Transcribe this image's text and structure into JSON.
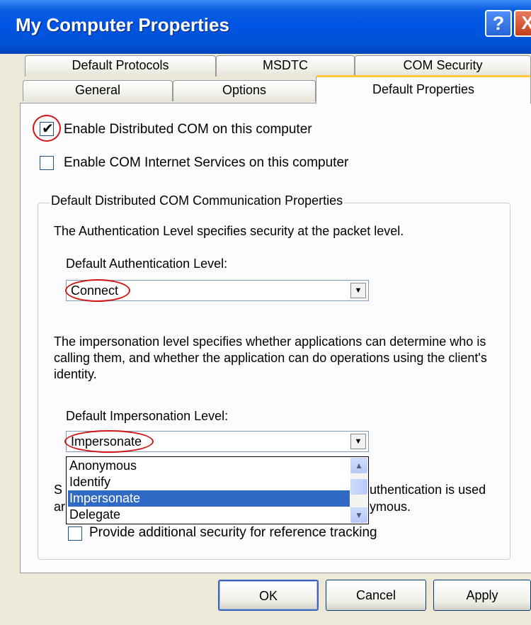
{
  "window": {
    "title": "My Computer Properties",
    "help_glyph": "?",
    "close_glyph": "X"
  },
  "tabs": {
    "row1": [
      {
        "label": "Default Protocols"
      },
      {
        "label": "MSDTC"
      },
      {
        "label": "COM Security"
      }
    ],
    "row2": [
      {
        "label": "General"
      },
      {
        "label": "Options"
      },
      {
        "label": "Default Properties",
        "selected": true
      }
    ]
  },
  "checkboxes": {
    "enable_dcom": {
      "label": "Enable Distributed COM on this computer",
      "checked": true
    },
    "enable_com_internet": {
      "label": "Enable COM Internet Services on this computer",
      "checked": false
    },
    "reference_tracking": {
      "label": "Provide additional security for reference tracking",
      "checked": false
    }
  },
  "group": {
    "title": "Default Distributed COM Communication Properties",
    "auth_description": "The Authentication Level specifies security at the packet level.",
    "auth_label": "Default Authentication Level:",
    "auth_value": "Connect",
    "imp_description": "The impersonation level specifies whether applications can determine who is calling them, and whether the application can do operations using the client's identity.",
    "imp_label": "Default Impersonation Level:",
    "imp_value": "Impersonate",
    "hidden_text_left_1": "S",
    "hidden_text_left_2": "ar",
    "hidden_text_right_1": "uthentication is used",
    "hidden_text_right_2": "ymous."
  },
  "impersonation_options": [
    {
      "label": "Anonymous"
    },
    {
      "label": "Identify"
    },
    {
      "label": "Impersonate",
      "selected": true
    },
    {
      "label": "Delegate"
    }
  ],
  "buttons": {
    "ok": "OK",
    "cancel": "Cancel",
    "apply": "Apply"
  },
  "colors": {
    "titlebar": "#0054e3",
    "selection": "#316ac5",
    "annotation": "#d21414"
  }
}
